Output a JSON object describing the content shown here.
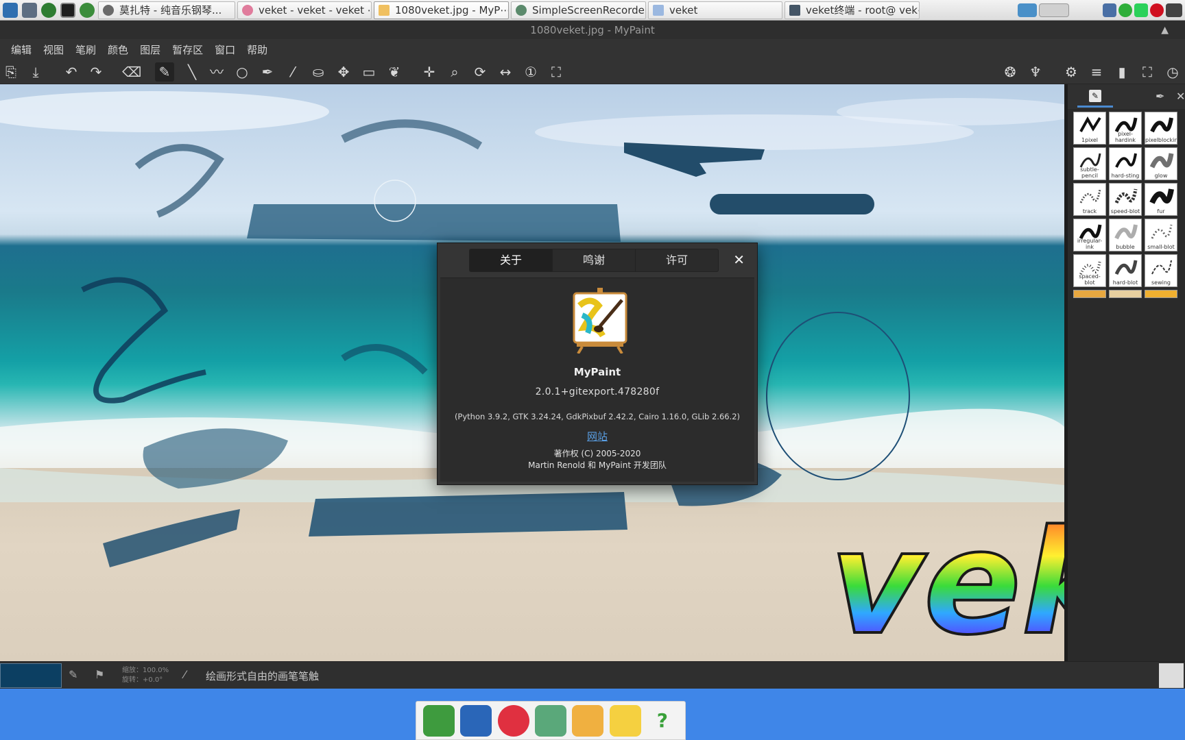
{
  "taskbar": {
    "tasks": [
      {
        "label": "莫扎特 - 纯音乐钢琴...",
        "color": "#6a6a6a"
      },
      {
        "label": "veket - veket - veket ⋯",
        "color": "#e07c9c"
      },
      {
        "label": "1080veket.jpg - MyP⋯",
        "color": "#f0c060"
      },
      {
        "label": "SimpleScreenRecorder",
        "color": "#5b8a6c"
      },
      {
        "label": "veket",
        "color": "#9bb8e0"
      },
      {
        "label": "veket终端 - root@ vek⋯",
        "color": "#445566"
      }
    ]
  },
  "window": {
    "title": "1080veket.jpg - MyPaint"
  },
  "menubar": {
    "items": [
      "编辑",
      "视图",
      "笔刷",
      "颜色",
      "图层",
      "暂存区",
      "窗口",
      "帮助"
    ]
  },
  "about": {
    "tabs": [
      "关于",
      "鸣谢",
      "许可"
    ],
    "selected_tab": "关于",
    "app_name": "MyPaint",
    "version": "2.0.1+gitexport.478280f",
    "libraries": "(Python 3.9.2, GTK 3.24.24, GdkPixbuf 2.42.2, Cairo 1.16.0, GLib 2.66.2)",
    "website": "网站",
    "copyright": "著作权 (C) 2005-2020",
    "authors": "Martin Renold 和 MyPaint 开发团队",
    "close_glyph": "✕"
  },
  "brushes": [
    "1pixel",
    "pixel-hardink",
    "pixelblocking",
    "subtle-pencil",
    "hard-sting",
    "glow",
    "track",
    "speed-blot",
    "fur",
    "irregular-ink",
    "bubble",
    "small-blot",
    "spaced-blot",
    "hard-blot",
    "sewing"
  ],
  "statusbar": {
    "zoom": "缩放：100.0%",
    "rotation": "旋转：+0.0°",
    "message": "绘画形式自由的画笔笔触",
    "current_color": "#0c3f62"
  },
  "canvas_text": "vek"
}
